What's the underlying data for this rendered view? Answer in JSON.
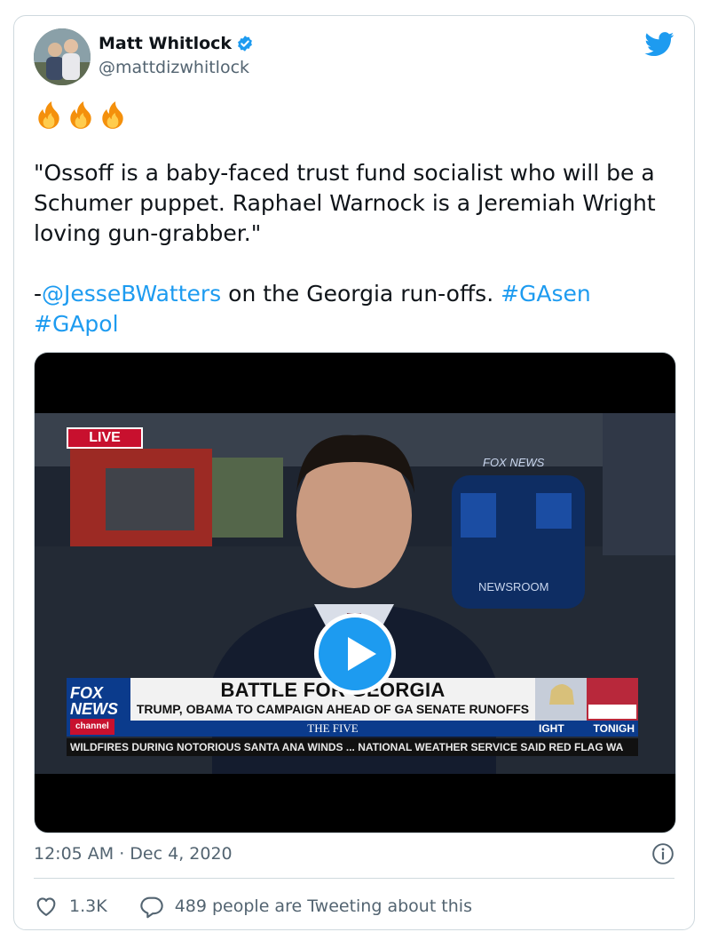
{
  "author": {
    "name": "Matt Whitlock",
    "handle": "@mattdizwhitlock",
    "verified": true
  },
  "tweet": {
    "emoji": [
      "fire-emoji",
      "fire-emoji",
      "fire-emoji"
    ],
    "quote": "\"Ossoff is a baby-faced trust fund socialist who will be a Schumer puppet. Raphael Warnock is a Jeremiah Wright loving gun-grabber.\"",
    "prefix": "-",
    "mention": "@JesseBWatters",
    "mid_text": " on the Georgia run-offs. ",
    "hashtag_1": "#GAsen",
    "hashtag_2": "#GApol"
  },
  "video": {
    "live_label": "LIVE",
    "bg_fox_news": "FOX NEWS",
    "bg_newsroom": "NEWSROOM",
    "logo_line1": "FOX",
    "logo_line2": "NEWS",
    "logo_channel": "channel",
    "headline": "BATTLE FOR GEORGIA",
    "subhead": "TRUMP, OBAMA TO CAMPAIGN AHEAD OF GA SENATE RUNOFFS",
    "show": "THE FIVE",
    "side_left": "IGHT",
    "side_right": "TONIGH",
    "ticker": "WILDFIRES DURING NOTORIOUS SANTA ANA WINDS ... NATIONAL WEATHER SERVICE SAID RED FLAG WA"
  },
  "meta": {
    "timestamp": "12:05 AM · Dec 4, 2020"
  },
  "actions": {
    "likes": "1.3K",
    "conversation": "489 people are Tweeting about this"
  },
  "colors": {
    "link": "#1d9bf0",
    "text": "#0f1419",
    "muted": "#536471",
    "border": "#cfd9de"
  }
}
